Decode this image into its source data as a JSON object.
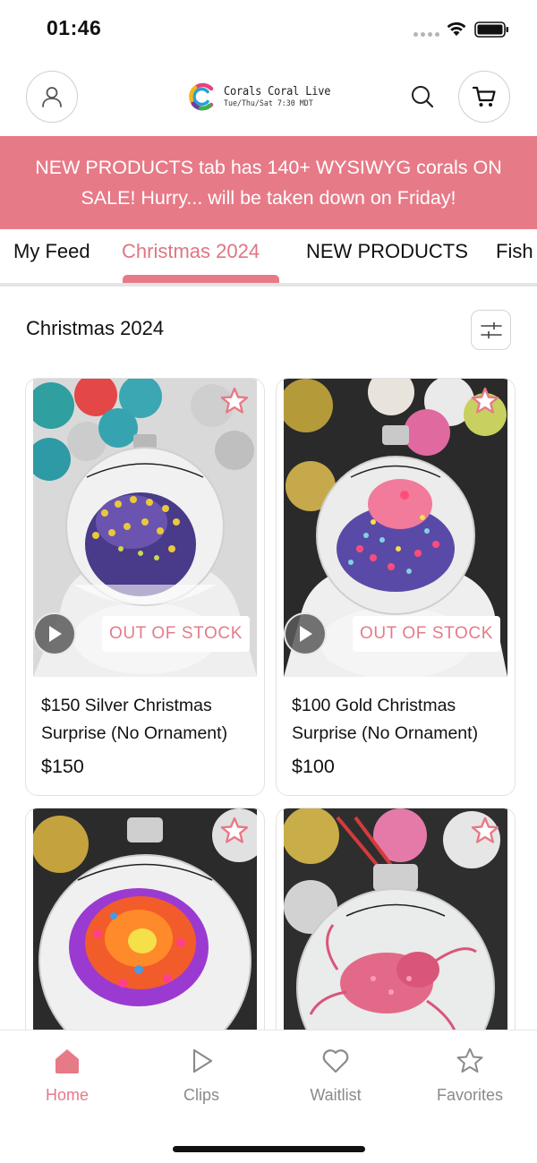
{
  "status_bar": {
    "time": "01:46",
    "icons": [
      "signal-dots-icon",
      "wifi-icon",
      "battery-icon"
    ]
  },
  "header": {
    "brand_name": "Corals Coral Live",
    "brand_schedule": "Tue/Thu/Sat 7:30 MDT",
    "icons": [
      "user-icon",
      "logo-icon",
      "search-icon",
      "cart-icon"
    ]
  },
  "banner": {
    "text": "NEW PRODUCTS tab has 140+ WYSIWYG corals ON SALE! Hurry... will be taken down on Friday!"
  },
  "tabs": [
    {
      "label": "My Feed",
      "active": false
    },
    {
      "label": "Christmas 2024",
      "active": true
    },
    {
      "label": "NEW PRODUCTS",
      "active": false
    },
    {
      "label": "Fish",
      "active": false
    }
  ],
  "section": {
    "title": "Christmas 2024",
    "filter_icon": "sliders-icon"
  },
  "products": [
    {
      "title": "$150 Silver Christmas Surprise (No Ornament)",
      "price": "$150",
      "badge": "OUT OF STOCK",
      "has_video": true,
      "favorite": false
    },
    {
      "title": "$100 Gold Christmas Surprise (No Ornament)",
      "price": "$100",
      "badge": "OUT OF STOCK",
      "has_video": true,
      "favorite": false
    },
    {
      "title": "",
      "price": "",
      "badge": "",
      "has_video": false,
      "favorite": false
    },
    {
      "title": "",
      "price": "",
      "badge": "",
      "has_video": false,
      "favorite": false
    }
  ],
  "bottom_nav": [
    {
      "label": "Home",
      "icon": "home-icon",
      "active": true
    },
    {
      "label": "Clips",
      "icon": "play-icon",
      "active": false
    },
    {
      "label": "Waitlist",
      "icon": "heart-icon",
      "active": false
    },
    {
      "label": "Favorites",
      "icon": "star-icon",
      "active": false
    }
  ],
  "colors": {
    "accent": "#e77a87",
    "accent_text": "#e07582",
    "nav_inactive": "#8a8a8a"
  }
}
